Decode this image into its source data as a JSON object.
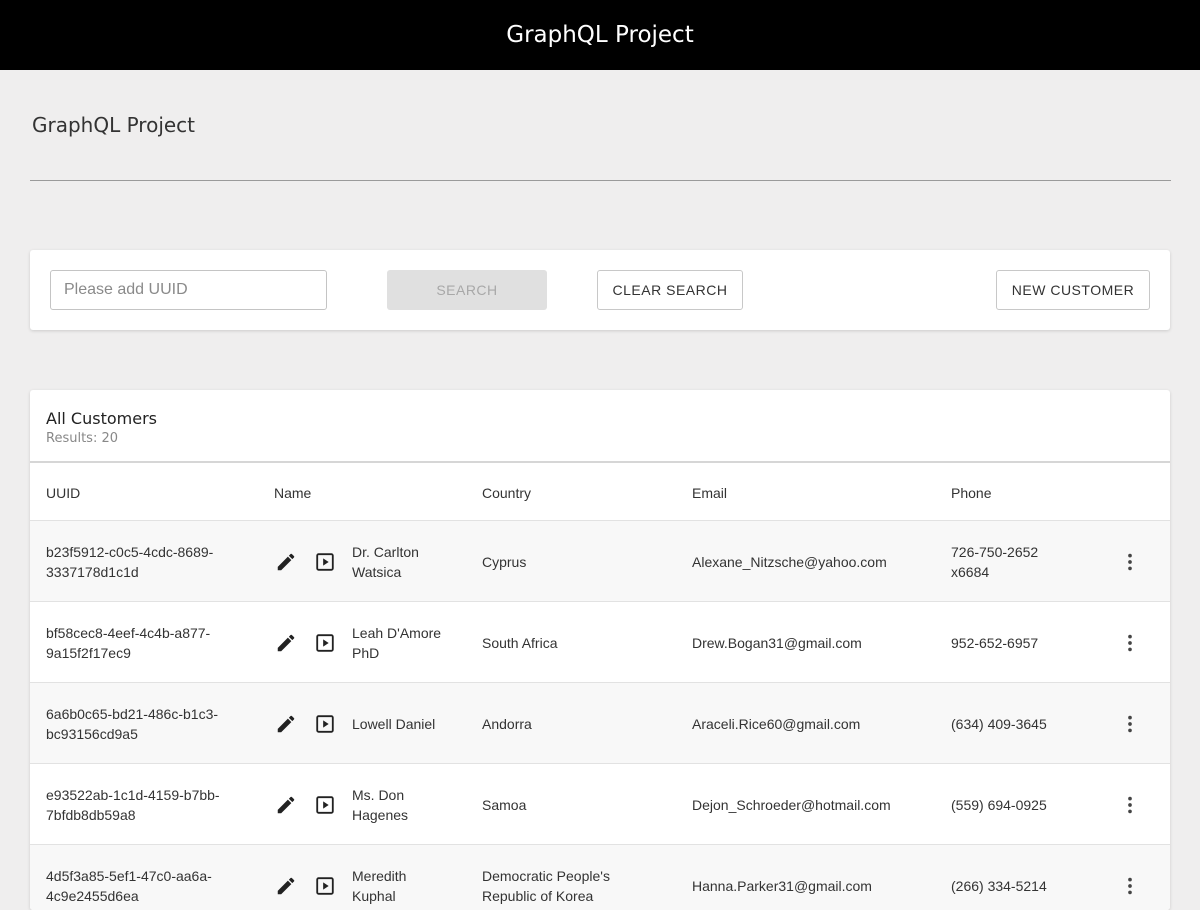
{
  "app": {
    "title": "GraphQL Project"
  },
  "page": {
    "title": "GraphQL Project"
  },
  "search": {
    "placeholder": "Please add UUID",
    "value": "",
    "search_label": "SEARCH",
    "clear_label": "CLEAR SEARCH",
    "new_label": "NEW CUSTOMER"
  },
  "table": {
    "title": "All Customers",
    "results": "Results: 20",
    "columns": [
      "UUID",
      "Name",
      "Country",
      "Email",
      "Phone"
    ],
    "rows": [
      {
        "uuid": [
          "b23f5912-c0c5-4cdc-8689-",
          "3337178d1c1d"
        ],
        "name": [
          "Dr. Carlton",
          "Watsica"
        ],
        "country": [
          "Cyprus"
        ],
        "email": "Alexane_Nitzsche@yahoo.com",
        "phone": [
          "726-750-2652",
          "x6684"
        ]
      },
      {
        "uuid": [
          "bf58cec8-4eef-4c4b-a877-",
          "9a15f2f17ec9"
        ],
        "name": [
          "Leah D'Amore",
          "PhD"
        ],
        "country": [
          "South Africa"
        ],
        "email": "Drew.Bogan31@gmail.com",
        "phone": [
          "952-652-6957"
        ]
      },
      {
        "uuid": [
          "6a6b0c65-bd21-486c-b1c3-",
          "bc93156cd9a5"
        ],
        "name": [
          "Lowell Daniel"
        ],
        "country": [
          "Andorra"
        ],
        "email": "Araceli.Rice60@gmail.com",
        "phone": [
          "(634) 409-3645"
        ]
      },
      {
        "uuid": [
          "e93522ab-1c1d-4159-b7bb-",
          "7bfdb8db59a8"
        ],
        "name": [
          "Ms. Don",
          "Hagenes"
        ],
        "country": [
          "Samoa"
        ],
        "email": "Dejon_Schroeder@hotmail.com",
        "phone": [
          "(559) 694-0925"
        ]
      },
      {
        "uuid": [
          "4d5f3a85-5ef1-47c0-aa6a-",
          "4c9e2455d6ea"
        ],
        "name": [
          "Meredith",
          "Kuphal"
        ],
        "country": [
          "Democratic People's",
          "Republic of Korea"
        ],
        "email": "Hanna.Parker31@gmail.com",
        "phone": [
          "(266) 334-5214"
        ]
      }
    ]
  },
  "icons": {
    "edit": "pencil-icon",
    "view": "play-box-icon",
    "more": "more-vert-icon"
  },
  "colors": {
    "topbar": "#000000",
    "background": "#efeeee",
    "card": "#ffffff"
  }
}
